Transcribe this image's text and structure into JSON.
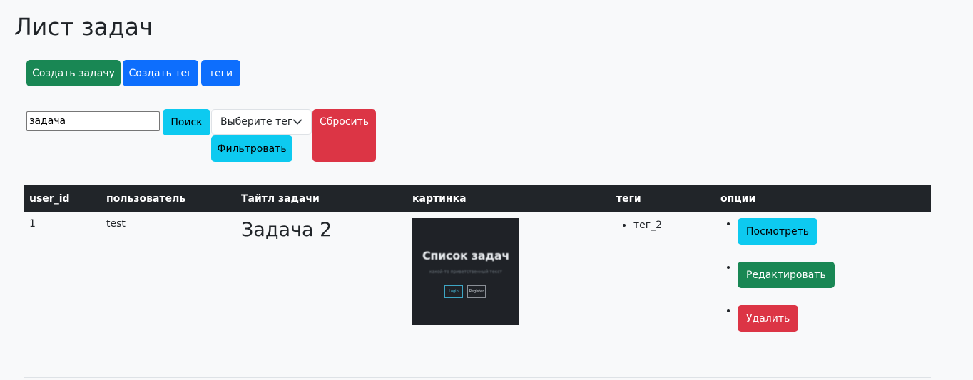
{
  "page": {
    "title": "Лист задач"
  },
  "toolbar": {
    "create_task_label": "Создать задачу",
    "create_tag_label": "Создать тег",
    "tags_label": "теги"
  },
  "search": {
    "value": "задача",
    "button_label": "Поиск"
  },
  "filter": {
    "select_value": "Выберите тег",
    "filter_button_label": "Фильтровать",
    "reset_button_label": "Сбросить"
  },
  "table": {
    "headers": [
      "user_id",
      "пользователь",
      "Тайтл задачи",
      "картинка",
      "теги",
      "опции"
    ],
    "rows": [
      {
        "user_id": "1",
        "user": "test",
        "title": "Задача 2",
        "image": {
          "title": "Список задач",
          "subtitle": "какой-то приветственный текст",
          "login": "Login",
          "register": "Register"
        },
        "tags": [
          "тег_2"
        ],
        "options": {
          "view": "Посмотреть",
          "edit": "Редактировать",
          "delete": "Удалить"
        }
      }
    ]
  },
  "colors": {
    "success": "#198754",
    "primary": "#0d6efd",
    "info": "#0dcaf0",
    "danger": "#dc3545",
    "dark": "#212529",
    "background": "#f8f9fa"
  }
}
